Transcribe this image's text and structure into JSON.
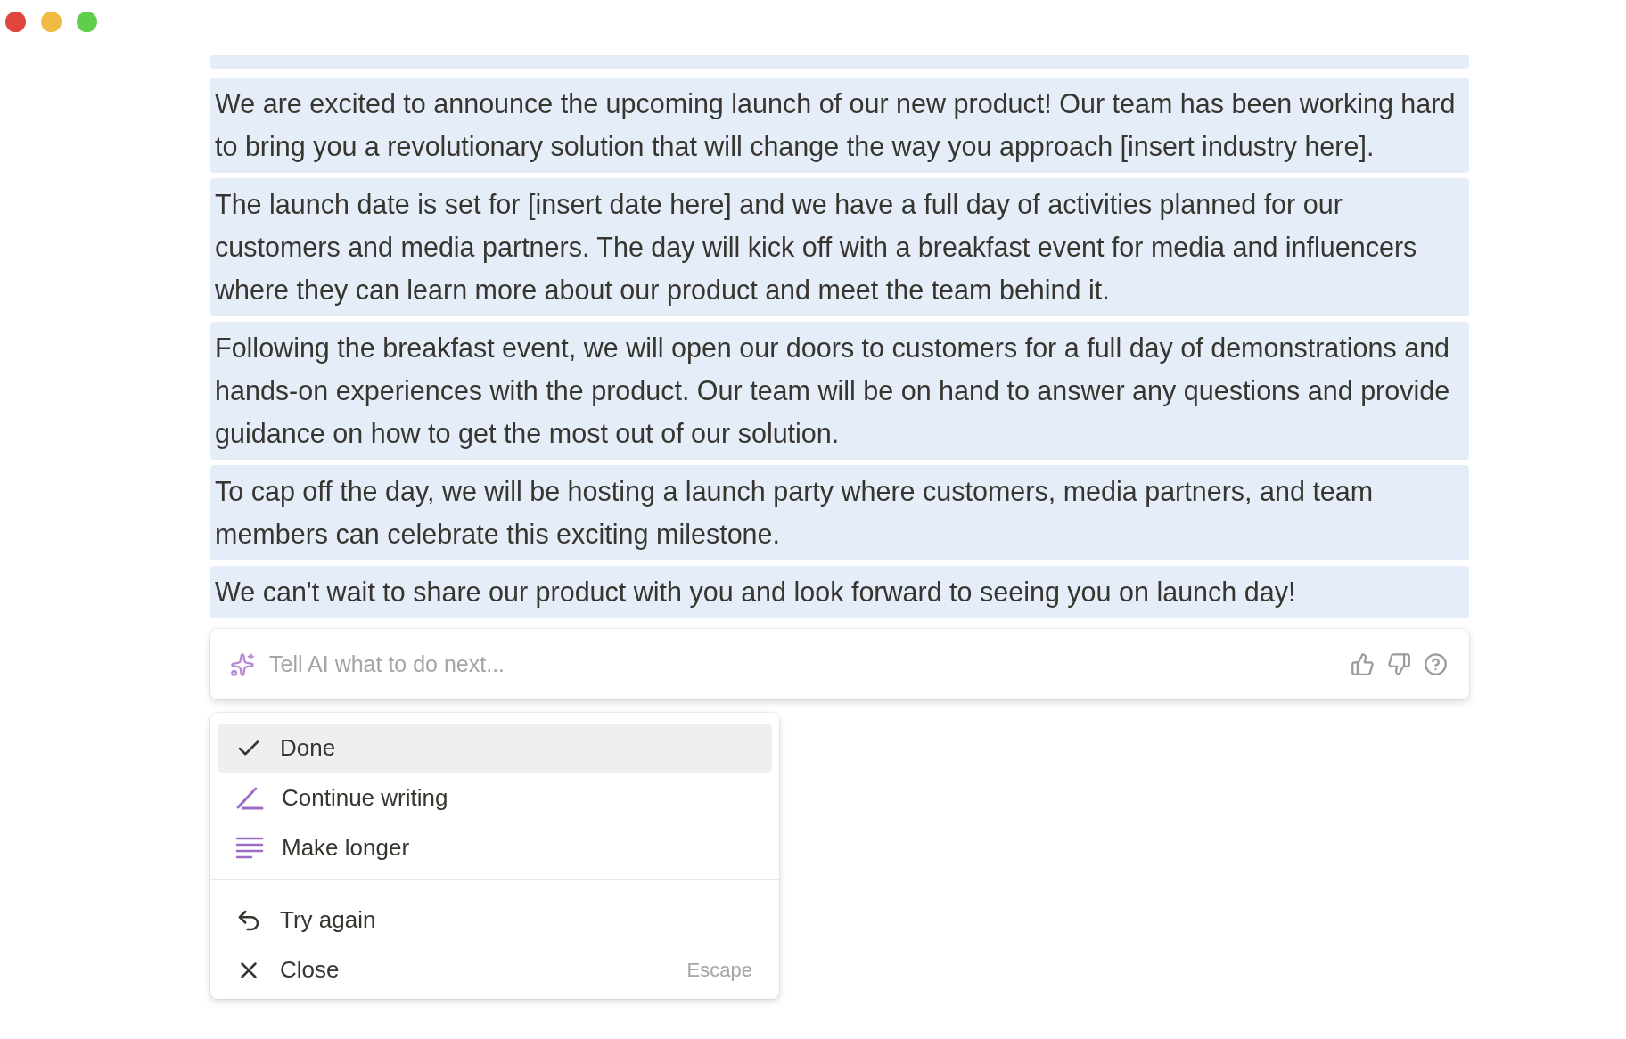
{
  "paragraphs": [
    {
      "text": "We are excited to announce the upcoming launch of our new product! Our team has been working hard to bring you a revolutionary solution that will change the way you approach [insert industry here]."
    },
    {
      "text": "The launch date is set for [insert date here] and we have a full day of activities planned for our customers and media partners. The day will kick off with a breakfast event for media and influencers where they can learn more about our product and meet the team behind it."
    },
    {
      "text": "Following the breakfast event, we will open our doors to customers for a full day of demonstrations and hands-on experiences with the product. Our team will be on hand to answer any questions and provide guidance on how to get the most out of our solution."
    },
    {
      "text": "To cap off the day, we will be hosting a launch party where customers, media partners, and team members can celebrate this exciting milestone."
    },
    {
      "text": "We can't wait to share our product with you and look forward to seeing you on launch day!"
    }
  ],
  "ai_prompt": {
    "placeholder": "Tell AI what to do next..."
  },
  "menu": {
    "groups": [
      {
        "items": [
          {
            "kind": "check",
            "label": "Done",
            "selected": true
          },
          {
            "kind": "pen",
            "label": "Continue writing",
            "selected": false
          },
          {
            "kind": "lines",
            "label": "Make longer",
            "selected": false
          }
        ]
      },
      {
        "items": [
          {
            "kind": "undo",
            "label": "Try again",
            "selected": false
          },
          {
            "kind": "close",
            "label": "Close",
            "shortcut": "Escape",
            "selected": false
          }
        ]
      }
    ]
  }
}
